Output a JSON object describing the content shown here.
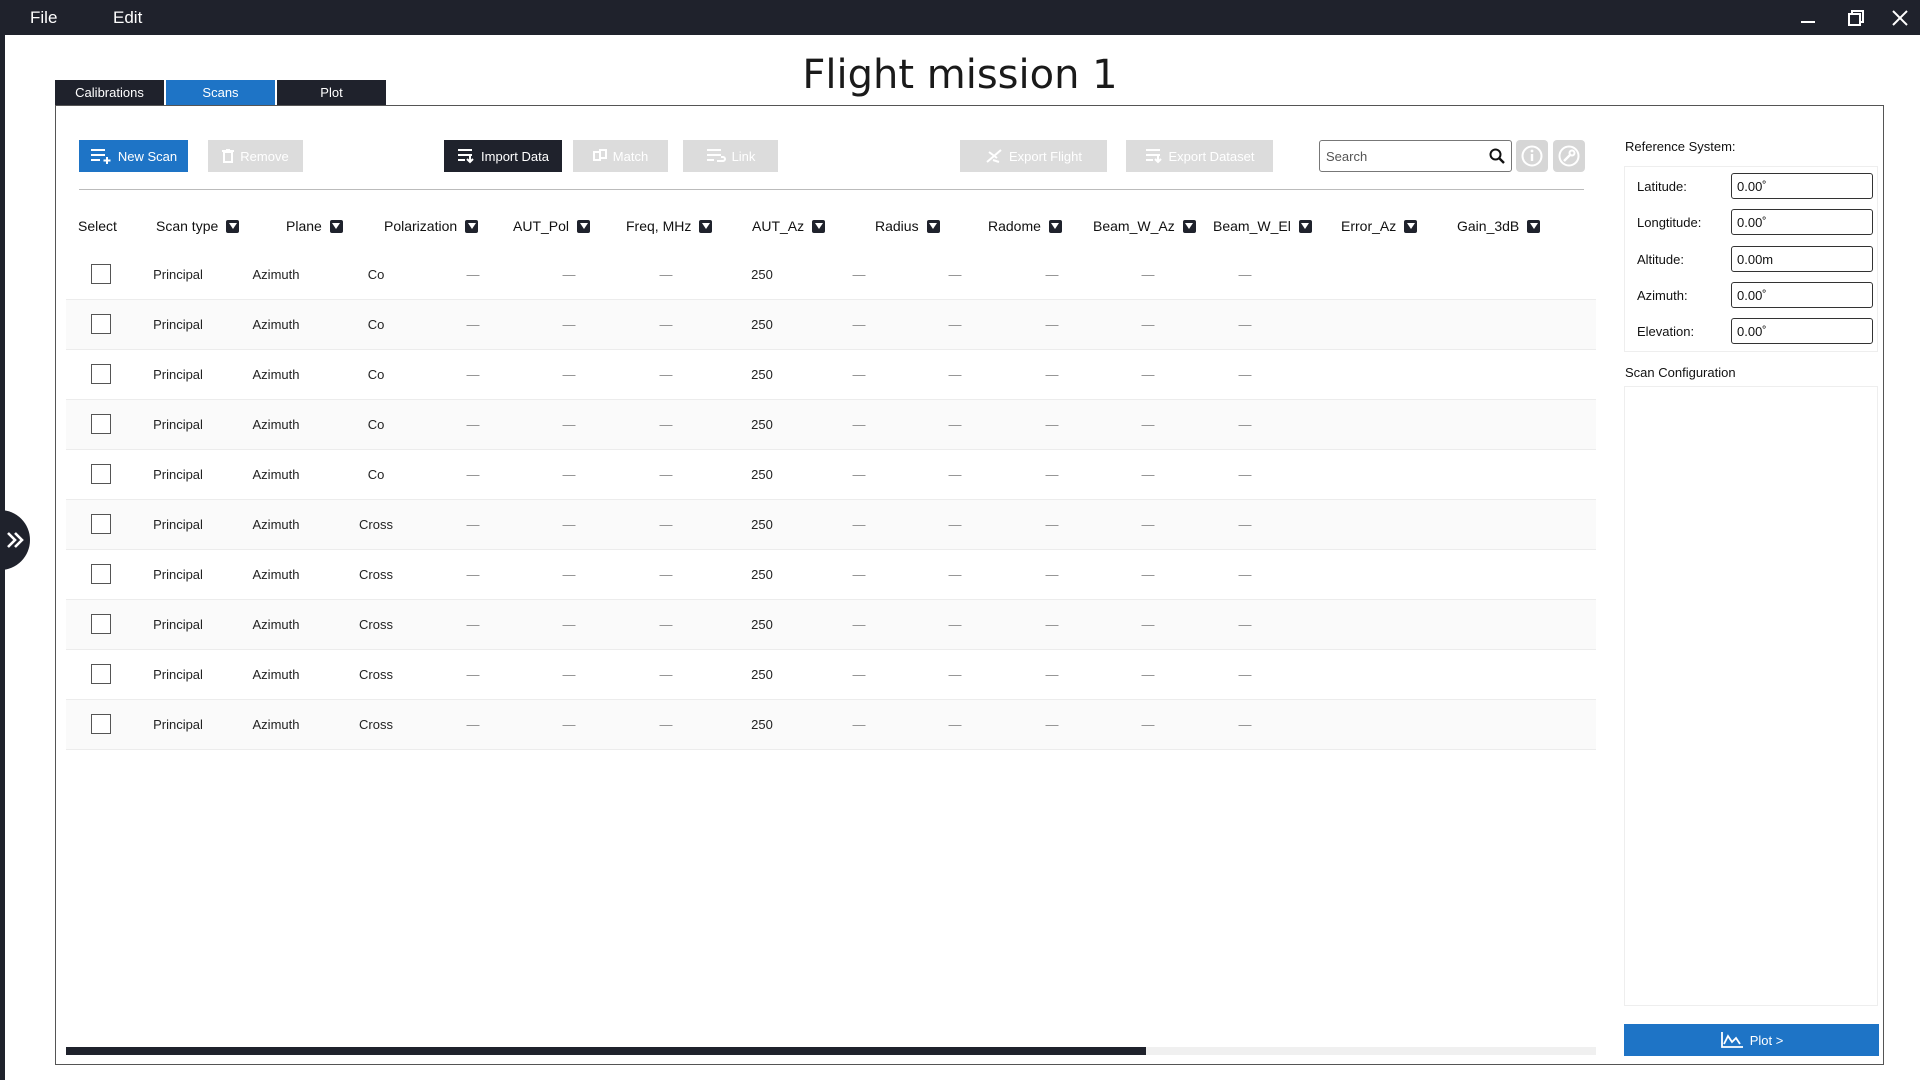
{
  "menu": {
    "file": "File",
    "edit": "Edit"
  },
  "page_title": "Flight mission 1",
  "tabs": [
    {
      "label": "Calibrations",
      "active": false
    },
    {
      "label": "Scans",
      "active": true
    },
    {
      "label": "Plot",
      "active": false
    }
  ],
  "toolbar": {
    "new_scan": "New Scan",
    "remove": "Remove",
    "import_data": "Import Data",
    "match": "Match",
    "link": "Link",
    "export_flight": "Export Flight",
    "export_dataset": "Export Dataset",
    "search_placeholder": "Search"
  },
  "table": {
    "headers": [
      "Select",
      "Scan type",
      "Plane",
      "Polarization",
      "AUT_Pol",
      "Freq, MHz",
      "AUT_Az",
      "Radius",
      "Radome",
      "Beam_W_Az",
      "Beam_W_El",
      "Error_Az",
      "Gain_3dB"
    ],
    "rows": [
      [
        "Principal",
        "Azimuth",
        "Co",
        "—",
        "—",
        "—",
        "250",
        "—",
        "—",
        "—",
        "—",
        "—"
      ],
      [
        "Principal",
        "Azimuth",
        "Co",
        "—",
        "—",
        "—",
        "250",
        "—",
        "—",
        "—",
        "—",
        "—"
      ],
      [
        "Principal",
        "Azimuth",
        "Co",
        "—",
        "—",
        "—",
        "250",
        "—",
        "—",
        "—",
        "—",
        "—"
      ],
      [
        "Principal",
        "Azimuth",
        "Co",
        "—",
        "—",
        "—",
        "250",
        "—",
        "—",
        "—",
        "—",
        "—"
      ],
      [
        "Principal",
        "Azimuth",
        "Co",
        "—",
        "—",
        "—",
        "250",
        "—",
        "—",
        "—",
        "—",
        "—"
      ],
      [
        "Principal",
        "Azimuth",
        "Cross",
        "—",
        "—",
        "—",
        "250",
        "—",
        "—",
        "—",
        "—",
        "—"
      ],
      [
        "Principal",
        "Azimuth",
        "Cross",
        "—",
        "—",
        "—",
        "250",
        "—",
        "—",
        "—",
        "—",
        "—"
      ],
      [
        "Principal",
        "Azimuth",
        "Cross",
        "—",
        "—",
        "—",
        "250",
        "—",
        "—",
        "—",
        "—",
        "—"
      ],
      [
        "Principal",
        "Azimuth",
        "Cross",
        "—",
        "—",
        "—",
        "250",
        "—",
        "—",
        "—",
        "—",
        "—"
      ],
      [
        "Principal",
        "Azimuth",
        "Cross",
        "—",
        "—",
        "—",
        "250",
        "—",
        "—",
        "—",
        "—",
        "—"
      ]
    ]
  },
  "reference_system": {
    "title": "Reference System:",
    "fields": [
      {
        "label": "Latitude:",
        "value": "0.00˚"
      },
      {
        "label": "Longtitude:",
        "value": "0.00˚"
      },
      {
        "label": "Altitude:",
        "value": "0.00m"
      },
      {
        "label": "Azimuth:",
        "value": "0.00˚"
      },
      {
        "label": "Elevation:",
        "value": "0.00˚"
      }
    ]
  },
  "scan_configuration": {
    "title": "Scan Configuration"
  },
  "plot_button": "Plot >",
  "colors": {
    "accent": "#1e74c6",
    "dark": "#1f222c",
    "disabled": "#dcdcdc"
  }
}
